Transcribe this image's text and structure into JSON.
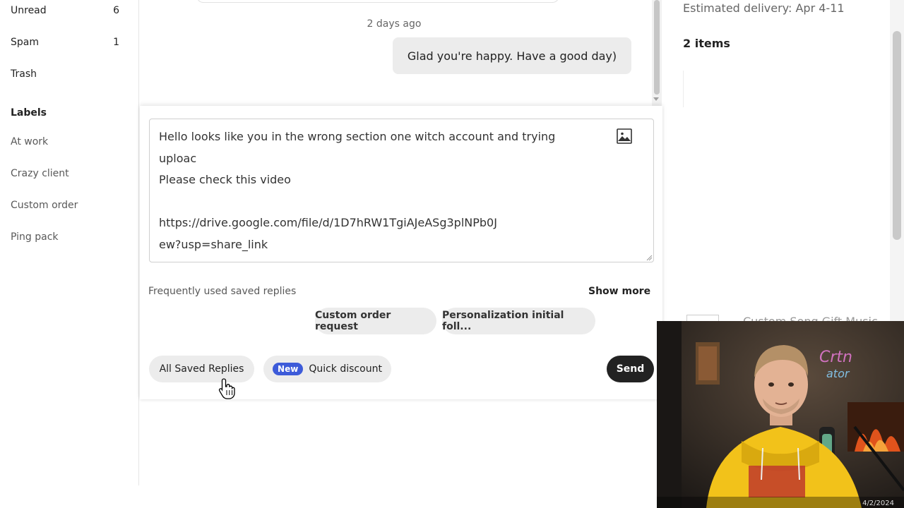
{
  "sidebar": {
    "items": [
      {
        "label": "Unread",
        "count": "6"
      },
      {
        "label": "Spam",
        "count": "1"
      },
      {
        "label": "Trash",
        "count": ""
      }
    ],
    "labels_heading": "Labels",
    "labels": [
      "At work",
      "Crazy client",
      "Custom order",
      "Ping pack"
    ]
  },
  "conversation": {
    "timestamp": "2 days ago",
    "last_message": "Glad you're happy. Have a good day)"
  },
  "reply": {
    "textarea_value": "Hello looks like you in the wrong section one witch account and trying\nuploac\nPlease check this video\n\nhttps://drive.google.com/file/d/1D7hRW1TgiAJeASg3plNPb0J\new?usp=share_link",
    "image_icon": "image-icon",
    "frequent_label": "Frequently used saved replies",
    "show_more": "Show more",
    "saved_replies": [
      "Custom order request",
      "Personalization initial foll..."
    ],
    "all_saved_replies": "All Saved Replies",
    "new_badge": "New",
    "quick_discount": "Quick discount",
    "send": "Send"
  },
  "order_panel": {
    "estimated_delivery": "Estimated delivery: Apr 4-11",
    "items_count": "2 items",
    "product_title": "Custom Song Gift Music"
  },
  "webcam": {
    "taskbar_date": "4/2/2024"
  },
  "colors": {
    "send_button": "#222222",
    "new_badge": "#3d5bd9",
    "pill_background": "#ececec"
  }
}
